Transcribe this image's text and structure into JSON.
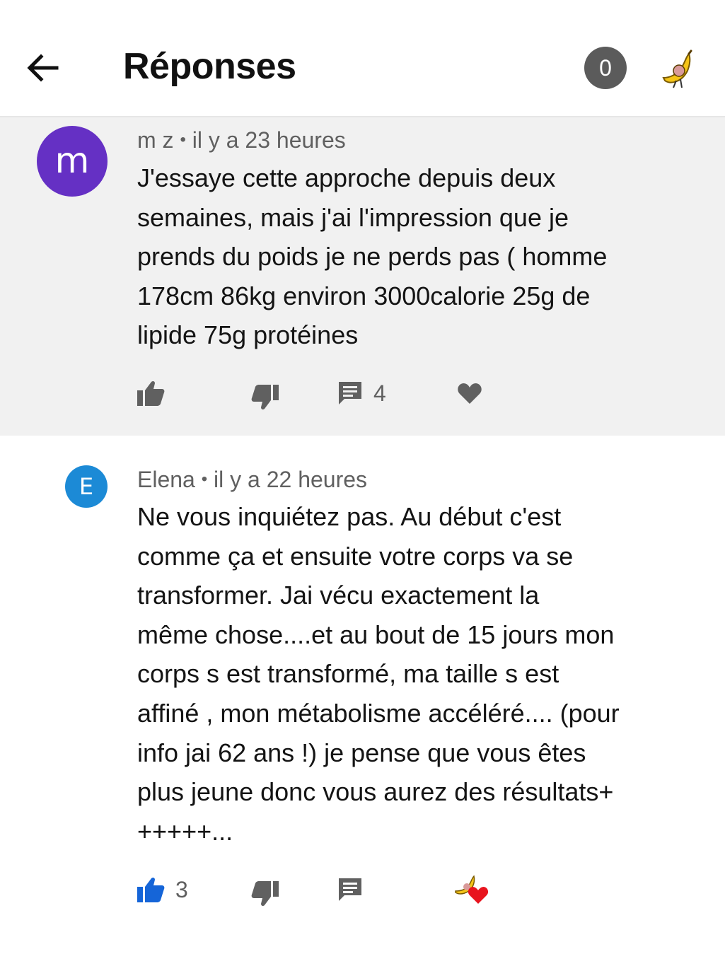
{
  "header": {
    "title": "Réponses",
    "badge_count": "0"
  },
  "comments": [
    {
      "avatar_letter": "m",
      "avatar_color": "#6530c4",
      "author": "m z",
      "time": "il y a 23 heures",
      "text": "J'essaye cette approche depuis deux\nsemaines, mais j'ai l'impression que je\nprends du poids je ne perds pas ( homme\n178cm 86kg environ 3000calorie 25g de\nlipide 75g protéines",
      "likes": "",
      "replies": "4"
    },
    {
      "avatar_letter": "E",
      "avatar_color": "#1c8ad6",
      "author": "Elena",
      "time": "il y a 22 heures",
      "text": "Ne vous inquiétez pas.  Au début c'est\ncomme ça et ensuite votre corps va se\ntransformer.  Jai vécu exactement la\nmême chose....et au bout de 15 jours mon\ncorps s est transformé, ma taille s est\naffiné , mon métabolisme accéléré.... (pour\ninfo jai 62 ans !) je pense que vous êtes\nplus jeune donc vous aurez des résultats+\n+++++...",
      "likes": "3",
      "replies": ""
    }
  ],
  "separator": "•",
  "colors": {
    "like_active": "#1565d8",
    "icon_gray": "#606060",
    "heart_red": "#e8141e"
  },
  "icons": [
    "back-arrow-icon",
    "banana-avatar-icon",
    "thumbs-up-icon",
    "thumbs-down-icon",
    "reply-icon",
    "heart-icon"
  ]
}
